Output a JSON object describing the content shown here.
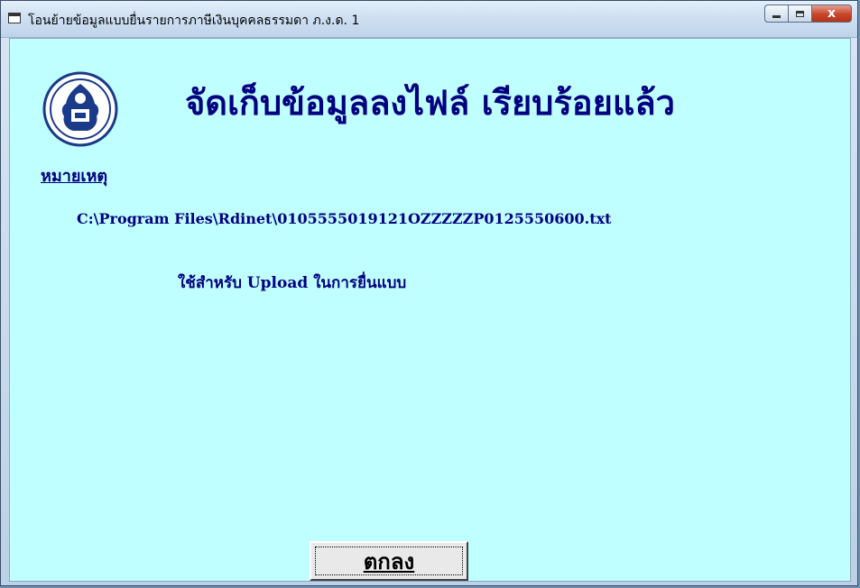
{
  "window": {
    "title": "โอนย้ายข้อมูลแบบยื่นรายการภาษีเงินบุคคลธรรมดา ภ.ง.ด. 1",
    "controls": {
      "minimize_icon": "minimize-icon",
      "maximize_icon": "maximize-icon",
      "close_label": "x"
    }
  },
  "content": {
    "logo_icon": "revenue-department-emblem",
    "headline": "จัดเก็บข้อมูลลงไฟล์ เรียบร้อยแล้ว",
    "note_label": "หมายเหตุ",
    "file_path": "C:\\Program Files\\Rdinet\\0105555019121OZZZZZP0125550600.txt",
    "usage_text": "ใช้สำหรับ Upload ในการยื่นแบบ"
  },
  "buttons": {
    "ok_label": "ตกลง"
  },
  "colors": {
    "client_background": "#c0ffff",
    "text": "#000080",
    "close_button": "#c8452a"
  }
}
